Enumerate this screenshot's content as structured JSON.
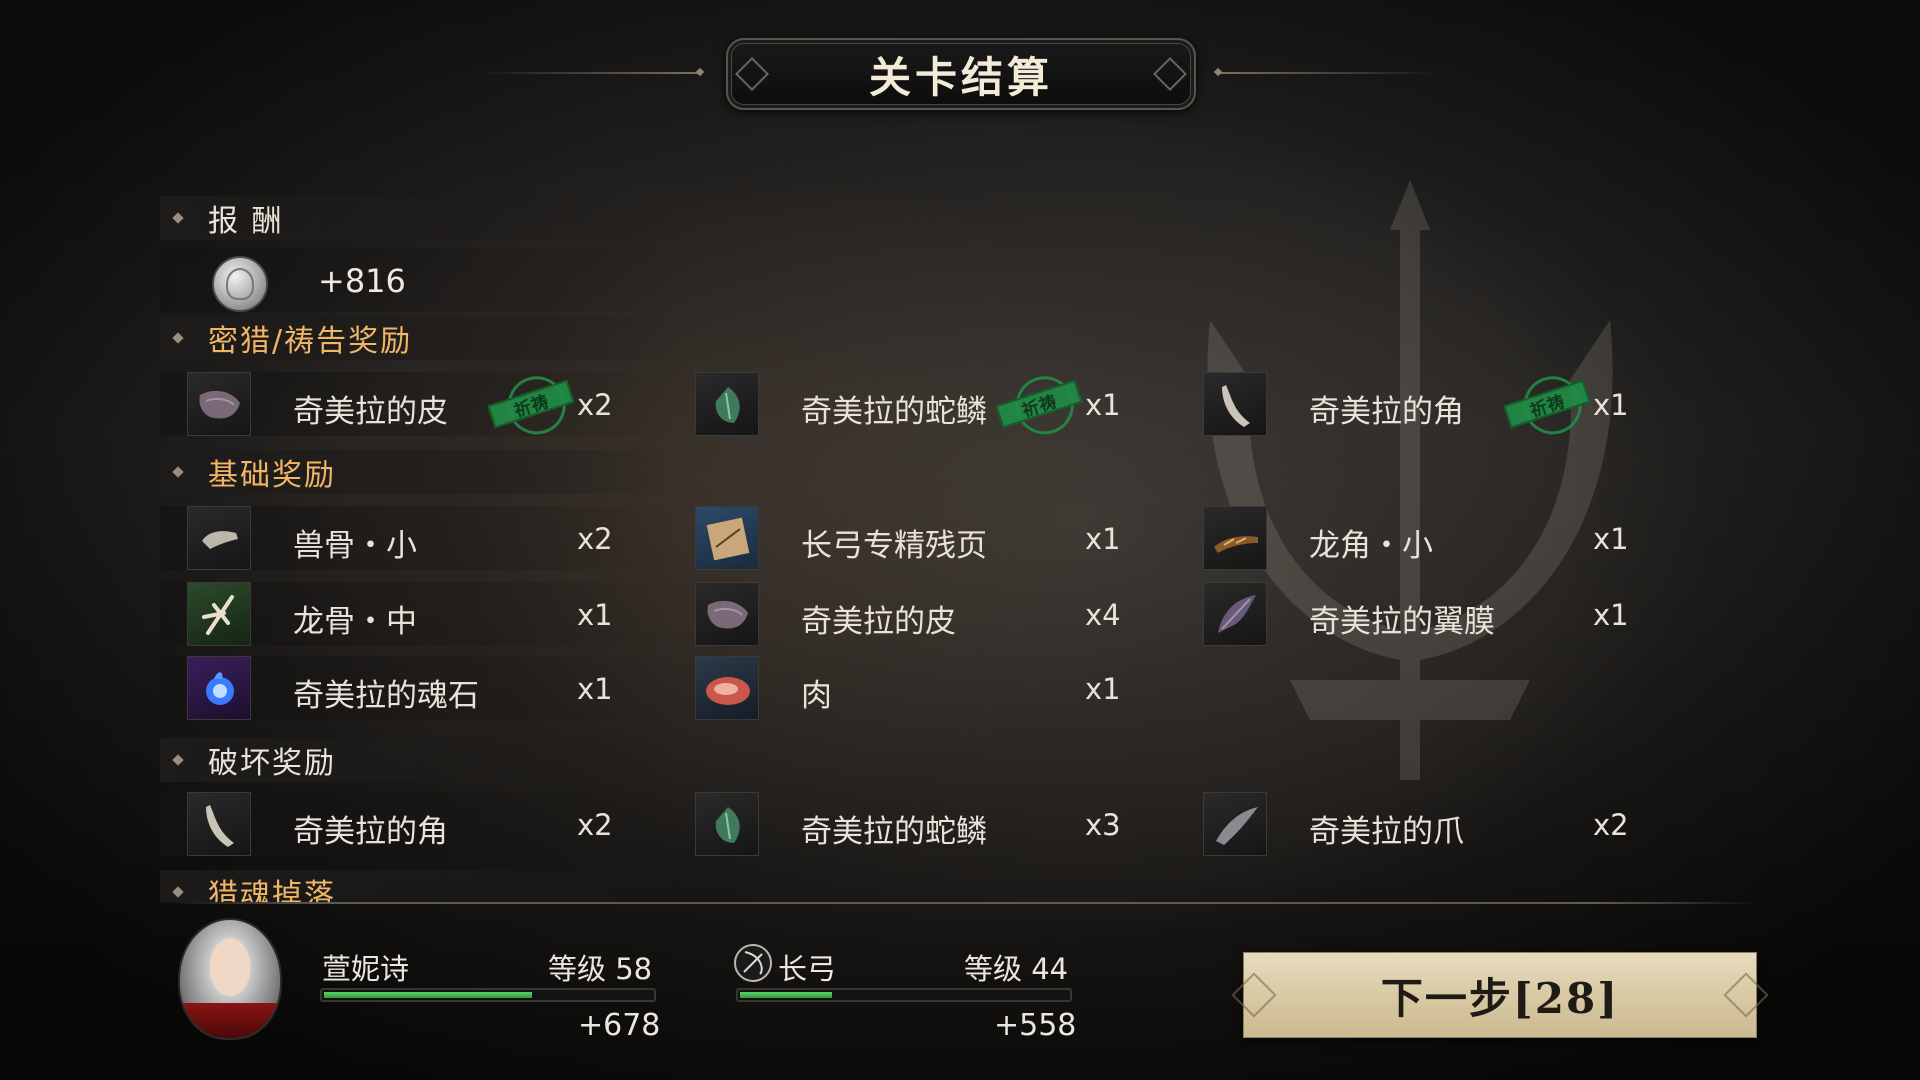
{
  "title": "关卡结算",
  "reward": {
    "header": "报 酬",
    "coin_value": "+816"
  },
  "sections": {
    "prayer": {
      "header": "密猎/祷告奖励",
      "items": [
        {
          "name": "奇美拉的皮",
          "qty": "x2",
          "stamp": "祈祷"
        },
        {
          "name": "奇美拉的蛇鳞",
          "qty": "x1",
          "stamp": "祈祷"
        },
        {
          "name": "奇美拉的角",
          "qty": "x1",
          "stamp": "祈祷"
        }
      ]
    },
    "basic": {
      "header": "基础奖励",
      "items": [
        {
          "name": "兽骨・小",
          "qty": "x2"
        },
        {
          "name": "长弓专精残页",
          "qty": "x1"
        },
        {
          "name": "龙角・小",
          "qty": "x1"
        },
        {
          "name": "龙骨・中",
          "qty": "x1"
        },
        {
          "name": "奇美拉的皮",
          "qty": "x4"
        },
        {
          "name": "奇美拉的翼膜",
          "qty": "x1"
        },
        {
          "name": "奇美拉的魂石",
          "qty": "x1"
        },
        {
          "name": "肉",
          "qty": "x1"
        }
      ]
    },
    "destroy": {
      "header": "破坏奖励",
      "items": [
        {
          "name": "奇美拉的角",
          "qty": "x2"
        },
        {
          "name": "奇美拉的蛇鳞",
          "qty": "x3"
        },
        {
          "name": "奇美拉的爪",
          "qty": "x2"
        }
      ]
    },
    "hunt": {
      "header": "猎魂掉落"
    }
  },
  "character": {
    "name": "萱妮诗",
    "level_text": "等级 58",
    "exp_gain": "+678",
    "exp_fraction": 0.64
  },
  "weapon": {
    "name": "长弓",
    "level_text": "等级 44",
    "exp_gain": "+558",
    "exp_fraction": 0.29,
    "icon": "bow-icon"
  },
  "next_button": "下一步[28]",
  "icons": {
    "hide": "hide-icon",
    "scale": "scale-icon",
    "horn": "horn-icon",
    "bone": "bone-icon",
    "page": "page-icon",
    "dragon_horn": "dragon-horn-icon",
    "dragon_bone": "dragon-bone-icon",
    "wing": "wing-membrane-icon",
    "soulstone": "soulstone-icon",
    "meat": "meat-icon",
    "claw": "claw-icon",
    "coin": "coin-icon"
  },
  "colors": {
    "gold_header": "#f0b566",
    "stamp_green": "#228c46",
    "exp_green": "#4fbf5c",
    "button_bg": "#d9caa5"
  }
}
